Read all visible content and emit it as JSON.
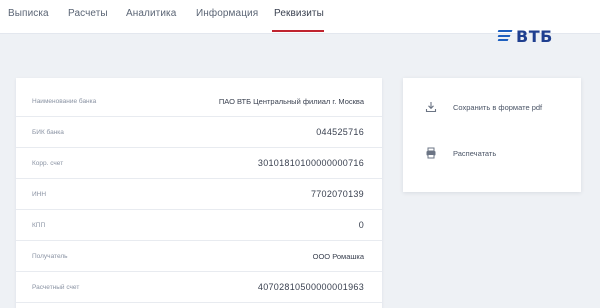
{
  "tabs": [
    {
      "label": "Выписка",
      "active": false
    },
    {
      "label": "Расчеты",
      "active": false
    },
    {
      "label": "Аналитика",
      "active": false
    },
    {
      "label": "Информация",
      "active": false
    },
    {
      "label": "Реквизиты",
      "active": true
    }
  ],
  "brand": {
    "name": "ВТБ",
    "color": "#1f3f8f",
    "accent": "#c0242f"
  },
  "requisites": [
    {
      "label": "Наименование банка",
      "value": "ПАО ВТБ Центральный филиал г. Москва"
    },
    {
      "label": "БИК банка",
      "value": "044525716"
    },
    {
      "label": "Корр. счет",
      "value": "30101810100000000716"
    },
    {
      "label": "ИНН",
      "value": "7702070139"
    },
    {
      "label": "КПП",
      "value": "0"
    },
    {
      "label": "Получатель",
      "value": "ООО Ромашка"
    },
    {
      "label": "Расчетный счет",
      "value": "40702810500000001963"
    }
  ],
  "actions": [
    {
      "label": "Сохранить в формате pdf",
      "icon": "download-icon"
    },
    {
      "label": "Распечатать",
      "icon": "printer-icon"
    }
  ]
}
